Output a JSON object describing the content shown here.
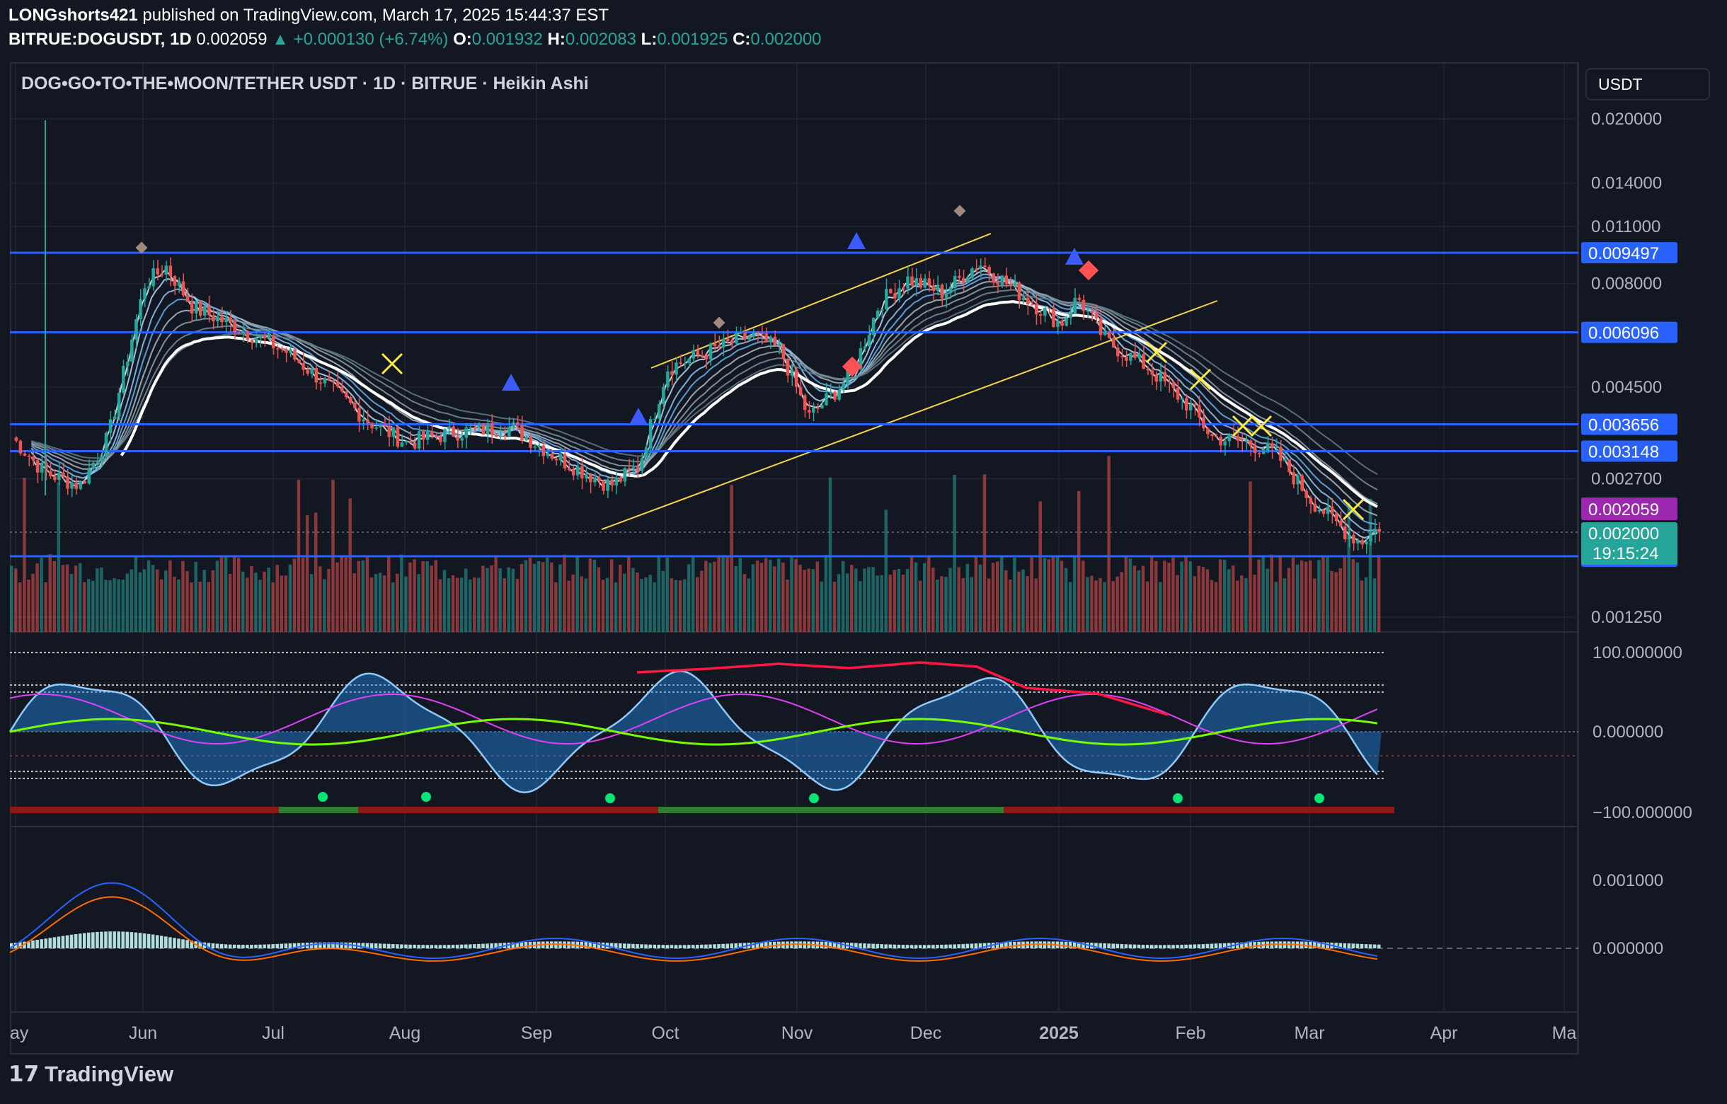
{
  "header": {
    "author": "LONGshorts421",
    "published": "published on TradingView.com, March 17, 2025 15:44:37 EST",
    "symbol": "BITRUE:DOGUSDT, 1D",
    "last": "0.002059",
    "change": "+0.000130 (+6.74%)",
    "o_label": "O:",
    "o": "0.001932",
    "h_label": "H:",
    "h": "0.002083",
    "l_label": "L:",
    "l": "0.001925",
    "c_label": "C:",
    "c": "0.002000"
  },
  "title_line": "DOG•GO•TO•THE•MOON/TETHER USDT · 1D · BITRUE · Heikin Ashi",
  "currency": "USDT",
  "footer_logo": "TradingView",
  "colors": {
    "background": "#131722",
    "bull": "#26a69a",
    "bear": "#ef5350",
    "level_line": "#2962ff",
    "ema": "#ffffff",
    "trend_channel": "#f5d547"
  },
  "chart_data": [
    {
      "type": "candlestick",
      "price_scale": "log",
      "y_ticks": [
        "0.020000",
        "0.014000",
        "0.011000",
        "0.008000",
        "0.004500",
        "0.002700",
        "0.001250"
      ],
      "x_ticks": [
        "ay",
        "Jun",
        "Jul",
        "Aug",
        "Sep",
        "Oct",
        "Nov",
        "Dec",
        "2025",
        "Feb",
        "Mar",
        "Apr",
        "Ma"
      ],
      "horizontal_levels": [
        "0.009497",
        "0.006096",
        "0.003656",
        "0.003148",
        "0.001754"
      ],
      "price_tags": [
        {
          "label": "0.002059",
          "color": "#9c27b0"
        },
        {
          "label": "0.002000",
          "sub": "19:15:24",
          "color": "#26a69a"
        }
      ],
      "series_close": [
        {
          "x": "May",
          "y": 0.0035
        },
        {
          "x": "Jun",
          "y": 0.009
        },
        {
          "x": "Jul",
          "y": 0.006
        },
        {
          "x": "Aug",
          "y": 0.0033
        },
        {
          "x": "Sep",
          "y": 0.0025
        },
        {
          "x": "Oct",
          "y": 0.0055
        },
        {
          "x": "Nov",
          "y": 0.004
        },
        {
          "x": "Dec",
          "y": 0.0095
        },
        {
          "x": "2025",
          "y": 0.007
        },
        {
          "x": "Feb",
          "y": 0.004
        },
        {
          "x": "Mar",
          "y": 0.0021
        }
      ]
    },
    {
      "type": "oscillator",
      "y_ticks": [
        "100.000000",
        "0.000000",
        "−100.000000"
      ]
    },
    {
      "type": "macd",
      "y_ticks": [
        "0.001000",
        "0.000000"
      ]
    }
  ]
}
